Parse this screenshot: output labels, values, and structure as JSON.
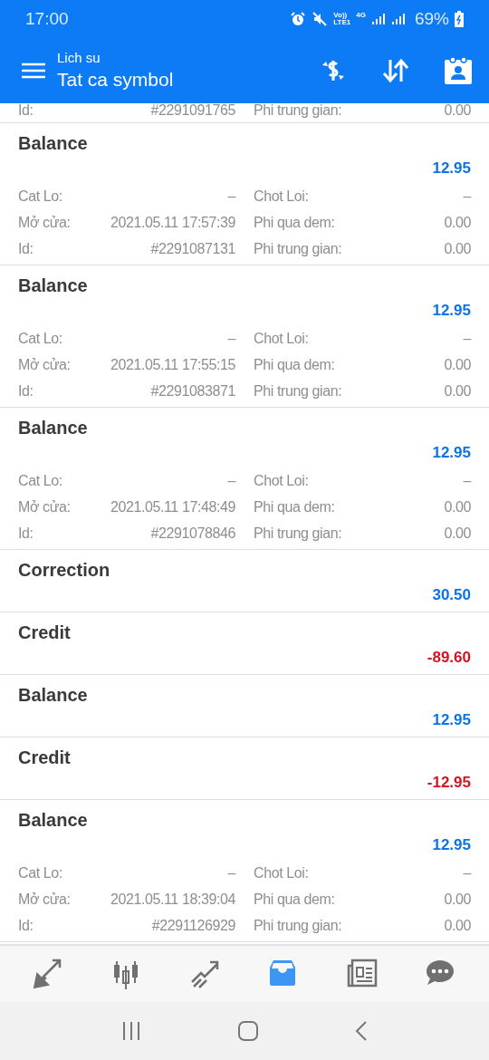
{
  "status_bar": {
    "time": "17:00",
    "volte_top": "Vo))",
    "volte_bottom": "LTE1",
    "network": "4G",
    "battery": "69%"
  },
  "app_bar": {
    "subtitle": "Lich su",
    "title": "Tat ca symbol"
  },
  "partial_row": [
    {
      "label": "Id:",
      "value": "#2291091765"
    },
    {
      "label": "Phi trung gian:",
      "value": "0.00"
    }
  ],
  "entries": [
    {
      "kind": "full",
      "title": "Balance",
      "amount": "12.95",
      "color": "#0b72e7",
      "fields": [
        {
          "label": "Cat Lo:",
          "value": "–"
        },
        {
          "label": "Chot Loi:",
          "value": "–"
        },
        {
          "label": "Mở cửa:",
          "value": "2021.05.11 17:57:39"
        },
        {
          "label": "Phi qua dem:",
          "value": "0.00"
        },
        {
          "label": "Id:",
          "value": "#2291087131"
        },
        {
          "label": "Phi trung gian:",
          "value": "0.00"
        }
      ]
    },
    {
      "kind": "full",
      "title": "Balance",
      "amount": "12.95",
      "color": "#0b72e7",
      "fields": [
        {
          "label": "Cat Lo:",
          "value": "–"
        },
        {
          "label": "Chot Loi:",
          "value": "–"
        },
        {
          "label": "Mở cửa:",
          "value": "2021.05.11 17:55:15"
        },
        {
          "label": "Phi qua dem:",
          "value": "0.00"
        },
        {
          "label": "Id:",
          "value": "#2291083871"
        },
        {
          "label": "Phi trung gian:",
          "value": "0.00"
        }
      ]
    },
    {
      "kind": "full",
      "title": "Balance",
      "amount": "12.95",
      "color": "#0b72e7",
      "fields": [
        {
          "label": "Cat Lo:",
          "value": "–"
        },
        {
          "label": "Chot Loi:",
          "value": "–"
        },
        {
          "label": "Mở cửa:",
          "value": "2021.05.11 17:48:49"
        },
        {
          "label": "Phi qua dem:",
          "value": "0.00"
        },
        {
          "label": "Id:",
          "value": "#2291078846"
        },
        {
          "label": "Phi trung gian:",
          "value": "0.00"
        }
      ]
    },
    {
      "kind": "short",
      "title": "Correction",
      "amount": "30.50",
      "color": "#0b72e7"
    },
    {
      "kind": "short",
      "title": "Credit",
      "amount": "-89.60",
      "color": "#d3131f"
    },
    {
      "kind": "short",
      "title": "Balance",
      "amount": "12.95",
      "color": "#0b72e7"
    },
    {
      "kind": "short",
      "title": "Credit",
      "amount": "-12.95",
      "color": "#d3131f"
    },
    {
      "kind": "full",
      "title": "Balance",
      "amount": "12.95",
      "color": "#0b72e7",
      "fields": [
        {
          "label": "Cat Lo:",
          "value": "–"
        },
        {
          "label": "Chot Loi:",
          "value": "–"
        },
        {
          "label": "Mở cửa:",
          "value": "2021.05.11 18:39:04"
        },
        {
          "label": "Phi qua dem:",
          "value": "0.00"
        },
        {
          "label": "Id:",
          "value": "#2291126929"
        },
        {
          "label": "Phi trung gian:",
          "value": "0.00"
        }
      ]
    }
  ],
  "bottom_nav": [
    {
      "selected": false
    },
    {
      "selected": false
    },
    {
      "selected": false
    },
    {
      "selected": true
    },
    {
      "selected": false
    },
    {
      "selected": false
    }
  ]
}
